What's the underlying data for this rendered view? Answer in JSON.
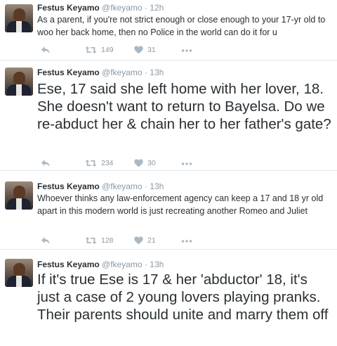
{
  "colors": {
    "name": "#292f33",
    "meta": "#8899a6",
    "action": "#aab8c2",
    "divider": "#e1e8ed"
  },
  "tweets": [
    {
      "name": "Festus Keyamo",
      "handle": "@fkeyamo",
      "separator": "·",
      "time": "12h",
      "text": "As a parent, if you're not strict enough or close enough to your 17-yr old to woo her back home, then no Police in the world can do it for u",
      "retweets": "149",
      "likes": "31"
    },
    {
      "name": "Festus Keyamo",
      "handle": "@fkeyamo",
      "separator": "·",
      "time": "13h",
      "text": "Ese, 17 said she left home with her lover, 18. She doesn't want to return to Bayelsa. Do we re-abduct her & chain her to her father's gate?",
      "retweets": "234",
      "likes": "30"
    },
    {
      "name": "Festus Keyamo",
      "handle": "@fkeyamo",
      "separator": "·",
      "time": "13h",
      "text": "Whoever thinks any law-enforcement agency can keep a 17 and 18 yr old apart in this modern world is just recreating another Romeo and Juliet",
      "retweets": "128",
      "likes": "21"
    },
    {
      "name": "Festus Keyamo",
      "handle": "@fkeyamo",
      "separator": "·",
      "time": "13h",
      "text": "If it's true Ese is 17 & her 'abductor' 18, it's just a case of 2 young lovers playing pranks. Their parents should unite and marry them off"
    }
  ]
}
